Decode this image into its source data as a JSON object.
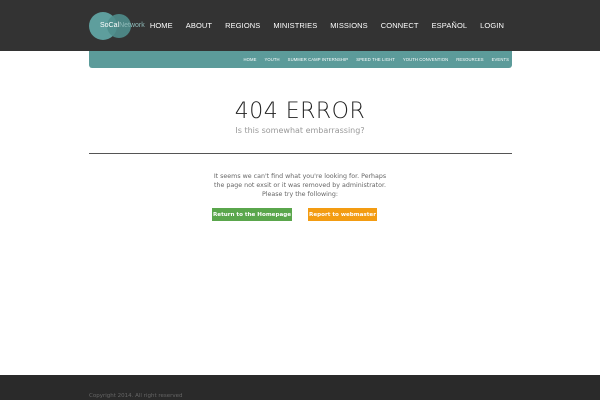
{
  "logo": {
    "part1": "SoCal",
    "part2": "Network"
  },
  "main_nav": [
    "HOME",
    "ABOUT",
    "REGIONS",
    "MINISTRIES",
    "MISSIONS",
    "CONNECT",
    "ESPAÑOL",
    "LOGIN"
  ],
  "sub_nav": [
    "HOME",
    "YOUTH",
    "SUMMER CAMP INTERNSHIP",
    "SPEED THE LIGHT",
    "YOUTH CONVENTION",
    "RESOURCES",
    "EVENTS"
  ],
  "error": {
    "title": "404 ERROR",
    "subtitle": "Is this somewhat embarrassing?",
    "message_line1": "It seems we can't find what you're looking for. Perhaps",
    "message_line2": "the page not exsit or it was removed by administrator.",
    "message_line3": "Please try the following:"
  },
  "buttons": {
    "home": "Return to the Homepage",
    "webmaster": "Report to webmaster"
  },
  "footer": {
    "copyright": "Copyright 2014. All right reserved"
  },
  "colors": {
    "header_bg": "#333333",
    "accent_teal": "#5c9b9a",
    "btn_green": "#5aa64c",
    "btn_orange": "#f39c12",
    "footer_bg": "#2a2a2a"
  }
}
